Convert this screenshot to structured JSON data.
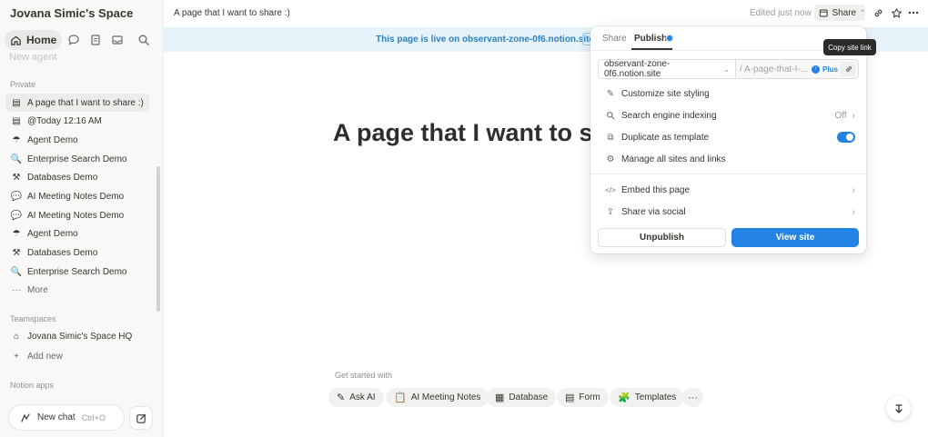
{
  "sidebar": {
    "workspace_title": "Jovana Simic's Space",
    "home_label": "Home",
    "ghost_row": "New agent",
    "private_label": "Private",
    "private_items": [
      {
        "icon": "page-icon",
        "glyph": "▤",
        "label": "A page that I want to share :)",
        "active": true
      },
      {
        "icon": "page-icon",
        "glyph": "▤",
        "label": "@Today 12:16 AM"
      },
      {
        "icon": "umbrella-icon",
        "glyph": "☂",
        "label": "Agent Demo"
      },
      {
        "icon": "magnifier-icon",
        "glyph": "🔍",
        "label": "Enterprise Search Demo"
      },
      {
        "icon": "tools-icon",
        "glyph": "⚒",
        "label": "Databases Demo"
      },
      {
        "icon": "speech-bubble-icon",
        "glyph": "💬",
        "label": "AI Meeting Notes Demo"
      },
      {
        "icon": "speech-bubble-icon",
        "glyph": "💬",
        "label": "AI Meeting Notes Demo"
      },
      {
        "icon": "umbrella-icon",
        "glyph": "☂",
        "label": "Agent Demo"
      },
      {
        "icon": "tools-icon",
        "glyph": "⚒",
        "label": "Databases Demo"
      },
      {
        "icon": "magnifier-icon",
        "glyph": "🔍",
        "label": "Enterprise Search Demo"
      },
      {
        "icon": "more-dots-icon",
        "glyph": "···",
        "label": "More"
      }
    ],
    "teamspaces_label": "Teamspaces",
    "teamspace_item": "Jovana Simic's Space HQ",
    "add_new_label": "Add new",
    "notion_apps_label": "Notion apps",
    "new_chat_label": "New chat",
    "new_chat_shortcut": "Ctrl+O"
  },
  "topbar": {
    "breadcrumb": "A page that I want to share :)",
    "edited": "Edited just now",
    "share_label": "Share"
  },
  "banner": {
    "text": "This page is live on observant-zone-0f6.notion.site"
  },
  "page": {
    "title": "A page that I want to share :)",
    "get_started": "Get started with",
    "chips": [
      {
        "icon": "ai-icon",
        "glyph": "✎",
        "label": "Ask AI"
      },
      {
        "icon": "clipboard-icon",
        "glyph": "📋",
        "label": "AI Meeting Notes"
      },
      {
        "icon": "table-icon",
        "glyph": "▦",
        "label": "Database"
      },
      {
        "icon": "form-icon",
        "glyph": "▤",
        "label": "Form"
      },
      {
        "icon": "templates-icon",
        "glyph": "🧩",
        "label": "Templates"
      },
      {
        "icon": "more-icon",
        "glyph": "···",
        "label": ""
      }
    ]
  },
  "popover": {
    "tab_share": "Share",
    "tab_publish": "Publish",
    "domain": "observant-zone-0f6.notion.site",
    "path": "/ A-page-that-I-...",
    "plus_label": "Plus",
    "rows": [
      {
        "icon": "brush-icon",
        "label": "Customize site styling"
      },
      {
        "icon": "search-icon",
        "label": "Search engine indexing",
        "value": "Off"
      },
      {
        "icon": "duplicate-icon",
        "label": "Duplicate as template"
      },
      {
        "icon": "gear-icon",
        "label": "Manage all sites and links"
      },
      {
        "icon": "code-icon",
        "label": "Embed this page"
      },
      {
        "icon": "share-out-icon",
        "label": "Share via social"
      }
    ],
    "unpublish_label": "Unpublish",
    "view_site_label": "View site",
    "duplicate_template_enabled": true
  },
  "tooltip": {
    "text": "Copy site link"
  },
  "colors": {
    "accent": "#2383e2",
    "banner_bg": "#e7f3fa",
    "sidebar_bg": "#f8f8f7"
  }
}
